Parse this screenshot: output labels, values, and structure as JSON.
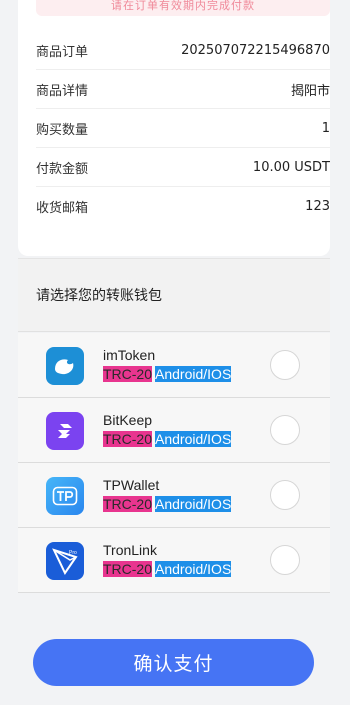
{
  "order": {
    "header_note": "请在订单有效期内完成付款",
    "rows": [
      {
        "label": "商品订单",
        "value": "202507072215496870"
      },
      {
        "label": "商品详情",
        "value": "揭阳市"
      },
      {
        "label": "购买数量",
        "value": "1"
      },
      {
        "label": "付款金额",
        "value": "10.00 USDT"
      },
      {
        "label": "收货邮箱",
        "value": "123"
      }
    ]
  },
  "wallet_section": {
    "title": "请选择您的转账钱包",
    "wallets": [
      {
        "name": "imToken",
        "tag_chain": "TRC-20",
        "tag_os": "Android/IOS",
        "icon": "imtoken-icon",
        "color": "#1d8fd6"
      },
      {
        "name": "BitKeep",
        "tag_chain": "TRC-20",
        "tag_os": "Android/IOS",
        "icon": "bitkeep-icon",
        "color": "#7b43f0"
      },
      {
        "name": "TPWallet",
        "tag_chain": "TRC-20",
        "tag_os": "Android/IOS",
        "icon": "tpwallet-icon",
        "color": "#2d9cf5"
      },
      {
        "name": "TronLink",
        "tag_chain": "TRC-20",
        "tag_os": "Android/IOS",
        "icon": "tronlink-icon",
        "color": "#1a5dd8"
      }
    ]
  },
  "confirm_button": "确认支付"
}
